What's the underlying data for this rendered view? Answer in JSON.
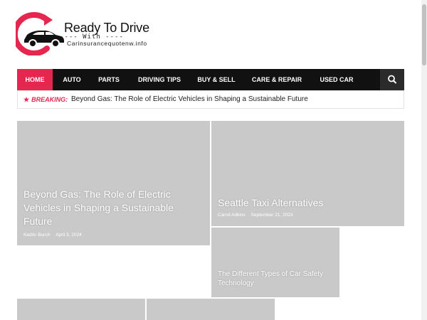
{
  "site": {
    "logo_title": "Ready To Drive",
    "logo_with": "---- With ----",
    "logo_domain": "Carinsurancequotenw.info"
  },
  "nav": {
    "items": [
      "HOME",
      "AUTO",
      "PARTS",
      "DRIVING TIPS",
      "BUY & SELL",
      "CARE & REPAIR",
      "USED CAR"
    ],
    "active": "HOME",
    "search_icon": "search-icon"
  },
  "breaking": {
    "label": "BREAKING:",
    "headline": "Beyond Gas: The Role of Electric Vehicles in Shaping a Sustainable Future"
  },
  "posts": [
    {
      "title": "Beyond Gas: The Role of Electric Vehicles in Shaping a Sustainable Future",
      "author": "Kedric Burch",
      "date": "April 3, 2024"
    },
    {
      "title": "Seattle Taxi Alternatives",
      "author": "Carrol Adkins",
      "date": "September 21, 2023"
    },
    {
      "title": "The Different Types of Car Safety Technology",
      "author": "",
      "date": ""
    }
  ],
  "colors": {
    "accent": "#e5264f",
    "nav_bg": "#111111",
    "card_bg": "#c9c9c9"
  }
}
